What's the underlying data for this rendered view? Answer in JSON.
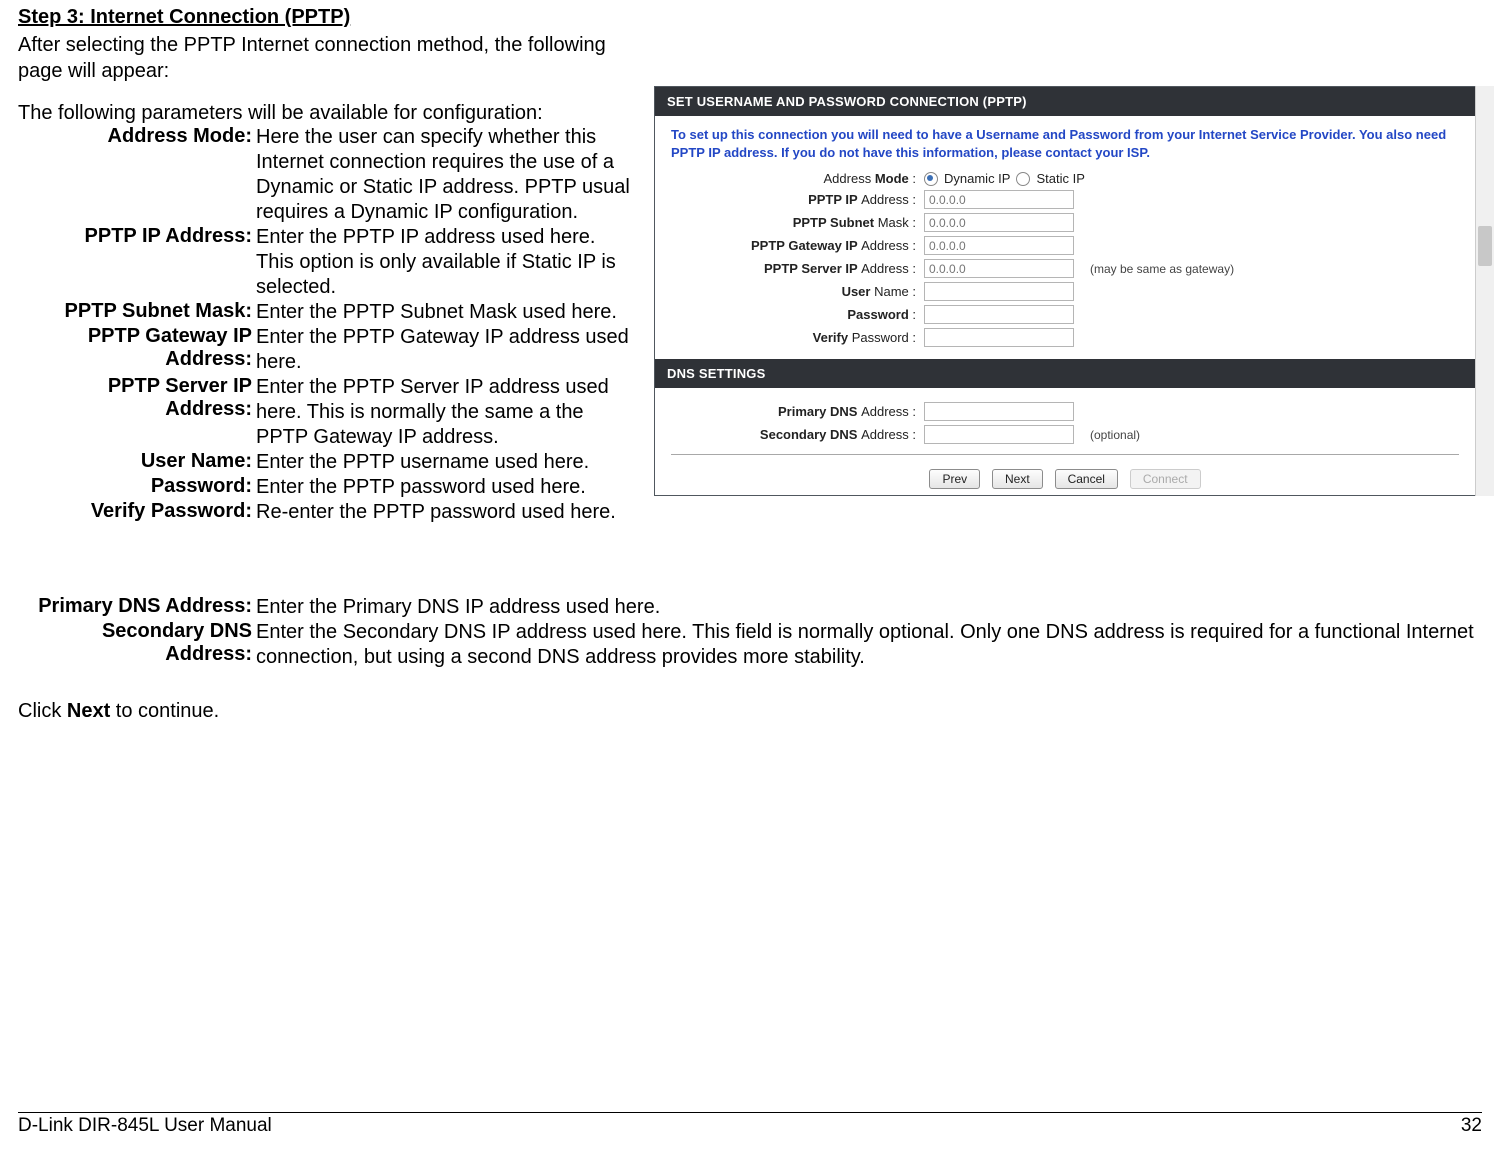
{
  "step_heading": "Step 3: Internet Connection (PPTP)",
  "intro": "After selecting the PPTP Internet connection method, the following page will appear:",
  "params_lead": "The following parameters will be available for configuration:",
  "params": [
    {
      "label": "Address Mode:",
      "desc": "Here the user can specify whether this Internet connection requires the use of a Dynamic or Static IP address. PPTP usual requires a Dynamic IP configuration."
    },
    {
      "label": "PPTP IP Address:",
      "desc": "Enter the PPTP IP address used here. This option is only available if Static IP is selected."
    },
    {
      "label": "PPTP Subnet Mask:",
      "desc": "Enter the PPTP Subnet Mask used here."
    },
    {
      "label": "PPTP Gateway IP Address:",
      "desc": "Enter the PPTP Gateway IP address used here."
    },
    {
      "label": "PPTP Server IP Address:",
      "desc": "Enter the PPTP Server IP address used here. This is normally the same a the PPTP Gateway IP address."
    },
    {
      "label": "User Name:",
      "desc": "Enter the PPTP username used here."
    },
    {
      "label": "Password:",
      "desc": "Enter the PPTP password used here."
    },
    {
      "label": "Verify Password:",
      "desc": "Re-enter the PPTP password used here."
    }
  ],
  "dns_params": [
    {
      "label": "Primary DNS Address:",
      "desc": "Enter the Primary DNS IP address used here."
    },
    {
      "label": "Secondary DNS Address:",
      "desc": "Enter the Secondary DNS IP address used here. This field is normally optional. Only one DNS address is required for a functional Internet connection, but using a second DNS address provides more stability."
    }
  ],
  "continue_pre": "Click ",
  "continue_bold": "Next",
  "continue_post": " to continue.",
  "shot": {
    "hdr1": "SET USERNAME AND PASSWORD CONNECTION (PPTP)",
    "intro": "To set up this connection you will need to have a Username and Password from your Internet Service Provider. You also need PPTP IP address. If you do not have this information, please contact your ISP.",
    "rows": {
      "addr_mode_lbl_norm": "Address ",
      "addr_mode_lbl_bold": "Mode",
      "addr_mode_colon": " :",
      "dyn": "Dynamic IP",
      "stat": "Static IP",
      "pptp_ip_lbl_bold": "PPTP IP ",
      "pptp_ip_lbl_norm": "Address :",
      "pptp_mask_lbl_bold": "PPTP Subnet ",
      "pptp_mask_lbl_norm": "Mask :",
      "pptp_gw_lbl_bold": "PPTP Gateway IP ",
      "pptp_gw_lbl_norm": "Address :",
      "pptp_srv_lbl_bold": "PPTP Server IP ",
      "pptp_srv_lbl_norm": "Address :",
      "srv_hint": "(may be same as gateway)",
      "user_lbl_bold": "User ",
      "user_lbl_norm": "Name :",
      "pwd_lbl_bold": "Password",
      "pwd_colon": " :",
      "vpwd_lbl_bold": "Verify ",
      "vpwd_lbl_norm": "Password :",
      "placeholder_ip": "0.0.0.0"
    },
    "hdr2": "DNS SETTINGS",
    "dns": {
      "p_lbl_bold": "Primary DNS ",
      "p_lbl_norm": "Address :",
      "s_lbl_bold": "Secondary DNS ",
      "s_lbl_norm": "Address :",
      "s_hint": "(optional)"
    },
    "buttons": {
      "prev": "Prev",
      "next": "Next",
      "cancel": "Cancel",
      "connect": "Connect"
    }
  },
  "footer": {
    "left": "D-Link DIR-845L User Manual",
    "right": "32"
  }
}
